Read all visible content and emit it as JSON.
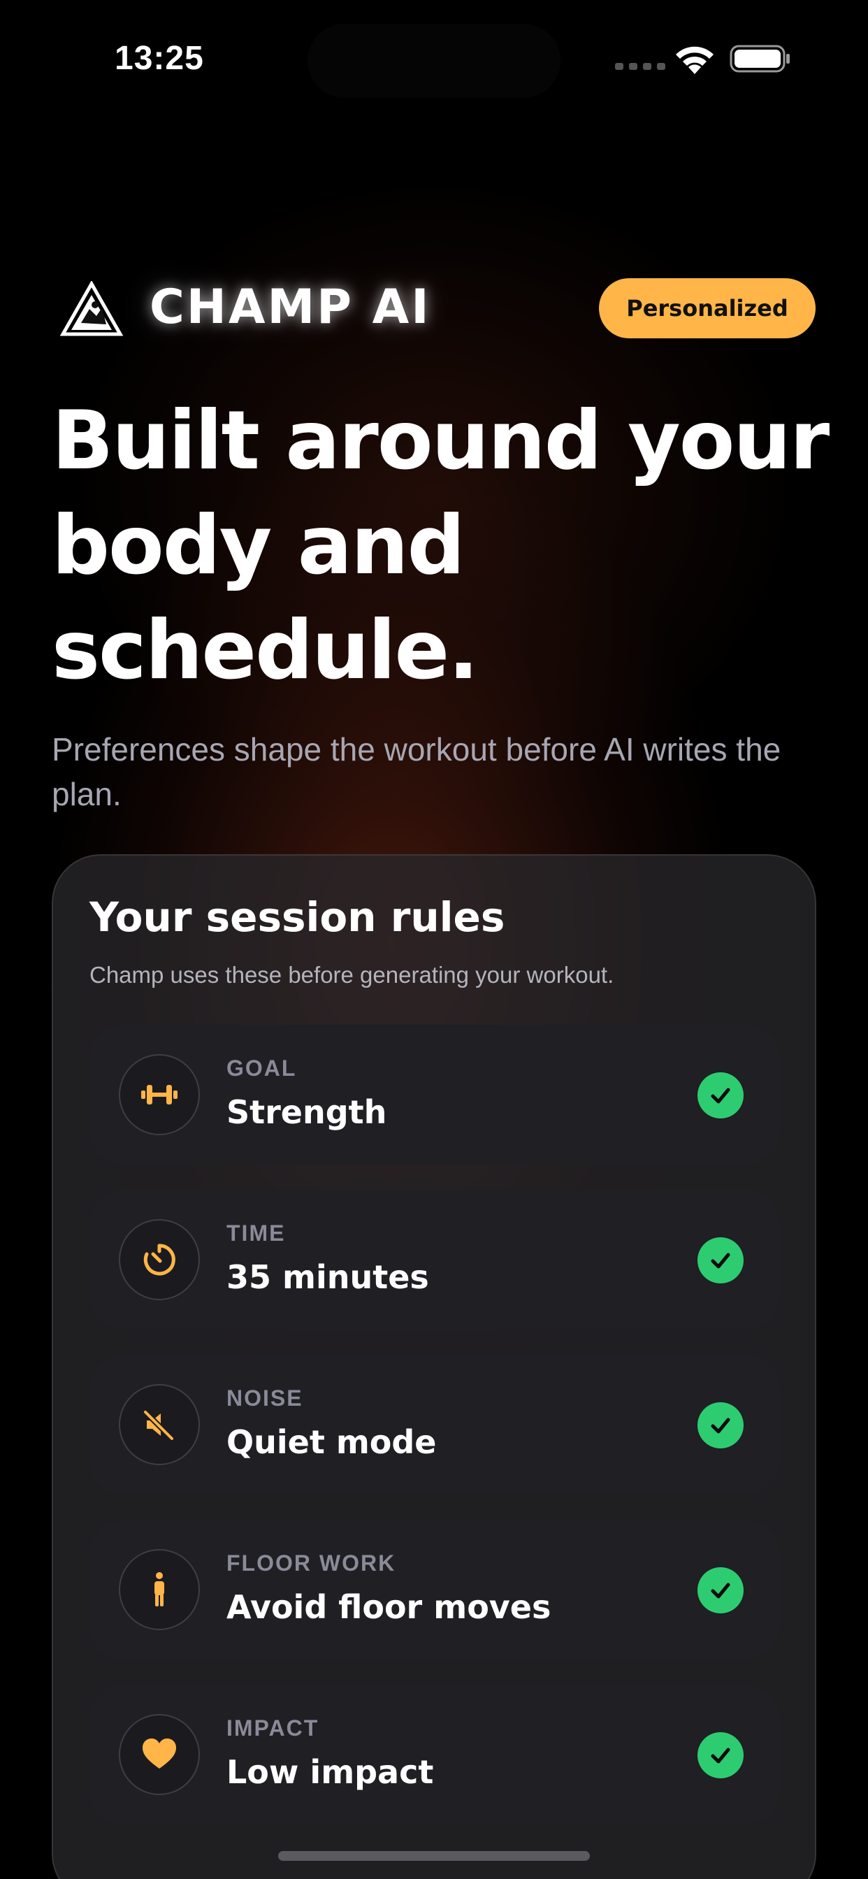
{
  "status_bar": {
    "time": "13:25"
  },
  "header": {
    "brand": "CHAMP AI",
    "badge": "Personalized"
  },
  "hero": {
    "headline": "Built around your body and schedule.",
    "subtitle": "Preferences shape the workout before AI writes the plan."
  },
  "card": {
    "title": "Your session rules",
    "subtitle": "Champ uses these before generating your workout.",
    "rules": [
      {
        "label": "GOAL",
        "value": "Strength",
        "icon": "dumbbell-icon",
        "checked": true
      },
      {
        "label": "TIME",
        "value": "35 minutes",
        "icon": "timer-icon",
        "checked": true
      },
      {
        "label": "NOISE",
        "value": "Quiet mode",
        "icon": "mute-icon",
        "checked": true
      },
      {
        "label": "FLOOR WORK",
        "value": "Avoid floor moves",
        "icon": "person-standing-icon",
        "checked": true
      },
      {
        "label": "IMPACT",
        "value": "Low impact",
        "icon": "heart-icon",
        "checked": true
      }
    ]
  },
  "colors": {
    "accent": "#ffb547",
    "check": "#2ecc71",
    "background": "#000000"
  }
}
